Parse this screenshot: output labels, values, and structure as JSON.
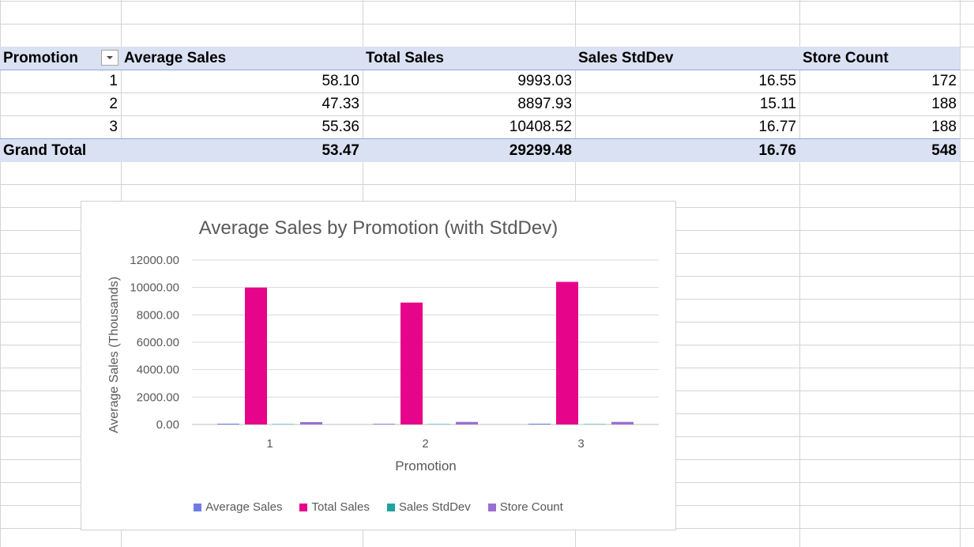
{
  "pivot": {
    "headers": [
      "Promotion",
      "Average Sales",
      "Total Sales",
      "Sales StdDev",
      "Store Count"
    ],
    "rows": [
      {
        "promotion": "1",
        "avg": "58.10",
        "total": "9993.03",
        "std": "16.55",
        "count": "172"
      },
      {
        "promotion": "2",
        "avg": "47.33",
        "total": "8897.93",
        "std": "15.11",
        "count": "188"
      },
      {
        "promotion": "3",
        "avg": "55.36",
        "total": "10408.52",
        "std": "16.77",
        "count": "188"
      }
    ],
    "grand_total": {
      "label": "Grand Total",
      "avg": "53.47",
      "total": "29299.48",
      "std": "16.76",
      "count": "548"
    },
    "filter_icon": "dropdown-arrow-icon"
  },
  "chart_data": {
    "type": "bar",
    "title": "Average Sales by Promotion (with StdDev)",
    "xlabel": "Promotion",
    "ylabel": "Average Sales (Thousands)",
    "categories": [
      "1",
      "2",
      "3"
    ],
    "ylim": [
      0,
      12000
    ],
    "yticks": [
      "0.00",
      "2000.00",
      "4000.00",
      "6000.00",
      "8000.00",
      "10000.00",
      "12000.00"
    ],
    "grid": true,
    "legend_position": "bottom",
    "series": [
      {
        "name": "Average Sales",
        "values": [
          58.1,
          47.33,
          55.36
        ],
        "color": "#6f7ce8"
      },
      {
        "name": "Total Sales",
        "values": [
          9993.03,
          8897.93,
          10408.52
        ],
        "color": "#e6058a"
      },
      {
        "name": "Sales StdDev",
        "values": [
          16.55,
          15.11,
          16.77
        ],
        "color": "#20a39e"
      },
      {
        "name": "Store Count",
        "values": [
          172,
          188,
          188
        ],
        "color": "#9b6fd1"
      }
    ]
  }
}
